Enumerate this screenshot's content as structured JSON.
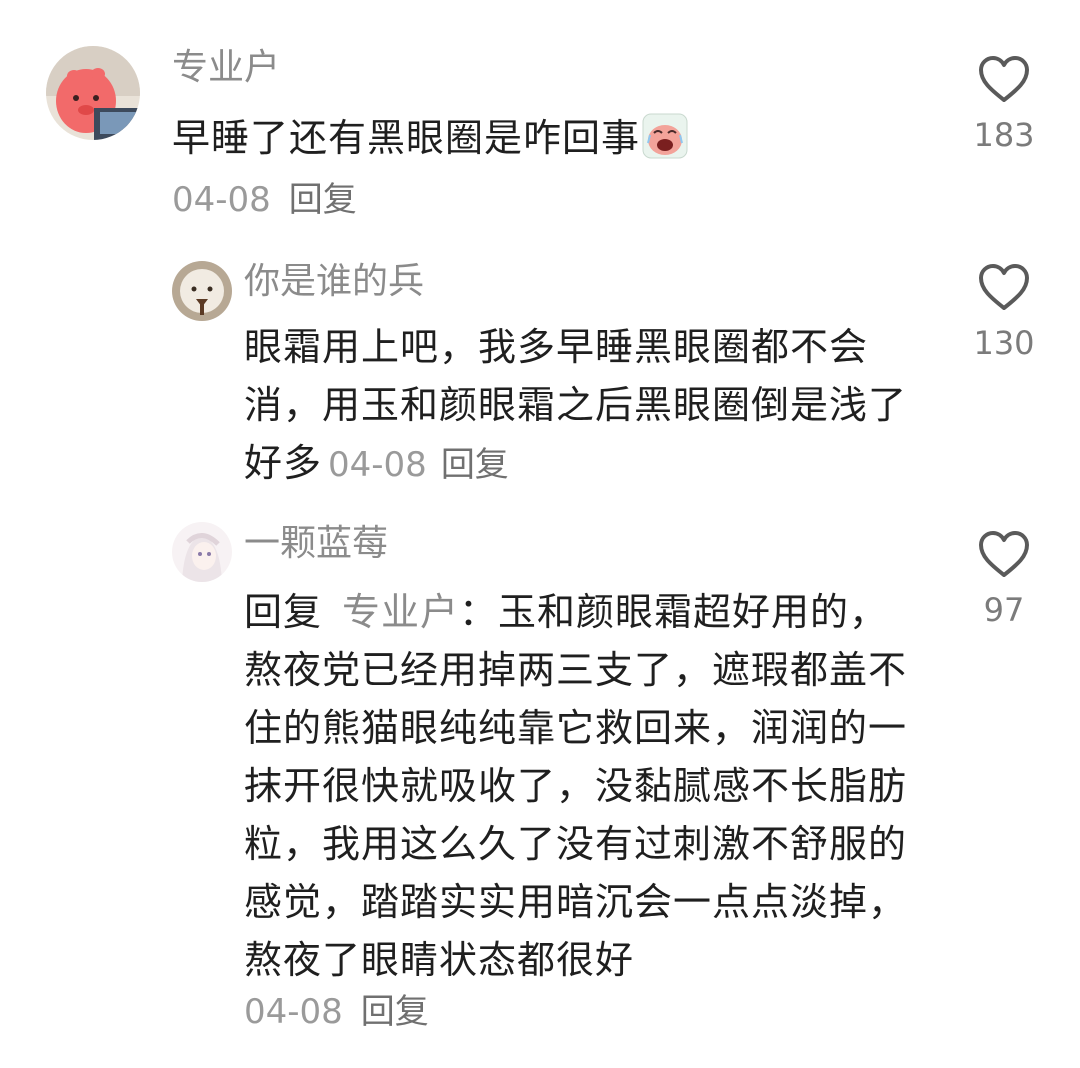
{
  "comments": [
    {
      "username": "专业户",
      "text": "早睡了还有黑眼圈是咋回事",
      "emoji": "crying-face-sticker",
      "date": "04-08",
      "reply_label": "回复",
      "likes": "183"
    },
    {
      "username": "你是谁的兵",
      "text": "眼霜用上吧，我多早睡黑眼圈都不会消，用玉和颜眼霜之后黑眼圈倒是浅了好多",
      "date": "04-08",
      "reply_label": "回复",
      "likes": "130"
    },
    {
      "username": "一颗蓝莓",
      "reply_prefix": "回复",
      "reply_target": "专业户",
      "text": "：玉和颜眼霜超好用的，熬夜党已经用掉两三支了，遮瑕都盖不住的熊猫眼纯纯靠它救回来，润润的一抹开很快就吸收了，没黏腻感不长脂肪粒，我用这么久了没有过刺激不舒服的感觉，踏踏实实用暗沉会一点点淡掉，熬夜了眼睛状态都很好",
      "date": "04-08",
      "reply_label": "回复",
      "likes": "97"
    }
  ],
  "colors": {
    "text": "#1f1f1f",
    "username": "#8b8b8b",
    "meta": "#9a9a9a",
    "heart": "#5a5a5a"
  },
  "icons": {
    "like": "heart-outline-icon"
  }
}
